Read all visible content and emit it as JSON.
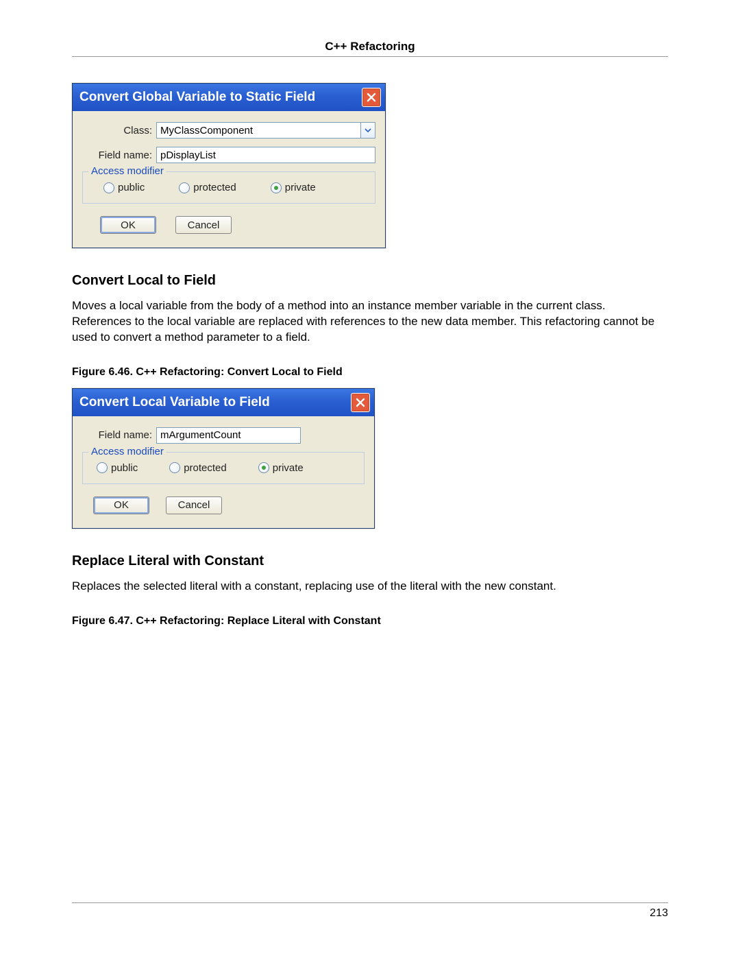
{
  "header": {
    "title": "C++ Refactoring"
  },
  "dialog1": {
    "title": "Convert Global Variable to Static Field",
    "class_label": "Class:",
    "class_value": "MyClassComponent",
    "field_label": "Field name:",
    "field_value": "pDisplayList",
    "fieldset_legend": "Access modifier",
    "radio_public": "public",
    "radio_protected": "protected",
    "radio_private": "private",
    "ok": "OK",
    "cancel": "Cancel"
  },
  "section1": {
    "heading": "Convert Local to Field",
    "body": "Moves a local variable from the body of a method into an instance member variable in the current class. References to the local variable are replaced with references to the new data member. This refactoring cannot be used to convert a method parameter to a field."
  },
  "figure1": {
    "caption": "Figure 6.46.  C++ Refactoring: Convert Local to Field"
  },
  "dialog2": {
    "title": "Convert Local Variable to Field",
    "field_label": "Field name:",
    "field_value": "mArgumentCount",
    "fieldset_legend": "Access modifier",
    "radio_public": "public",
    "radio_protected": "protected",
    "radio_private": "private",
    "ok": "OK",
    "cancel": "Cancel"
  },
  "section2": {
    "heading": "Replace Literal with Constant",
    "body": "Replaces the selected literal with a constant, replacing use of the literal with the new constant."
  },
  "figure2": {
    "caption": "Figure 6.47.  C++ Refactoring: Replace Literal with Constant"
  },
  "footer": {
    "page_number": "213"
  }
}
